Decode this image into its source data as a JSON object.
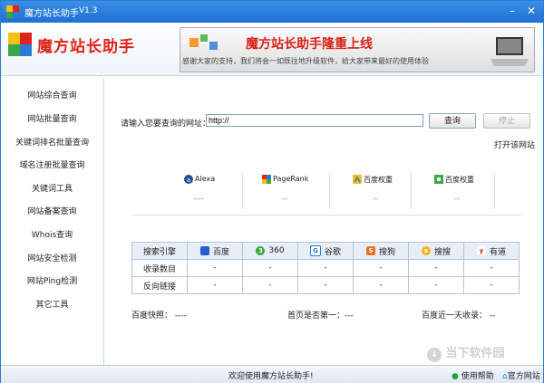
{
  "window": {
    "title": "魔方站长助手",
    "version": "V1.3"
  },
  "header": {
    "logo_text": "魔方站长助手",
    "banner_title": "魔方站长助手隆重上线",
    "banner_subtitle": "感谢大家的支持，我们将会一如既往地升级软件，给大家带来最好的使用体验"
  },
  "sidebar": {
    "items": [
      {
        "label": "网站综合查询"
      },
      {
        "label": "网站批量查询"
      },
      {
        "label": "关键词排名批量查询"
      },
      {
        "label": "域名注册批量查询"
      },
      {
        "label": "关键词工具"
      },
      {
        "label": "网站备案查询"
      },
      {
        "label": "Whois查询"
      },
      {
        "label": "网站安全检测"
      },
      {
        "label": "网站Ping检测"
      },
      {
        "label": "其它工具"
      }
    ]
  },
  "query": {
    "label": "请输入您要查询的网址：",
    "url_value": "http://",
    "search_button": "查询",
    "stop_button": "停止",
    "open_site": "打开该网站"
  },
  "ranks": [
    {
      "name": "Alexa",
      "value": "----"
    },
    {
      "name": "PageRank",
      "value": "--"
    },
    {
      "name": "百度权重",
      "value": "--"
    },
    {
      "name": "百度权重",
      "value": "--"
    }
  ],
  "table": {
    "header": "搜索引擎",
    "engines": [
      "百度",
      "360",
      "谷歌",
      "搜狗",
      "搜搜",
      "有道"
    ],
    "rows": [
      {
        "label": "收录数目",
        "values": [
          "-",
          "-",
          "-",
          "-",
          "-",
          "-"
        ]
      },
      {
        "label": "反向链接",
        "values": [
          "-",
          "-",
          "-",
          "-",
          "-",
          "-"
        ]
      }
    ]
  },
  "stats": {
    "snapshot_label": "百度快照：",
    "snapshot_value": "----",
    "homepage_label": "首页是否第一：",
    "homepage_value": "---",
    "recent_label": "百度近一天收录：",
    "recent_value": "--"
  },
  "status": {
    "welcome": "欢迎使用魔方站长助手!",
    "help": "使用帮助",
    "site": "官方网站"
  },
  "watermark": "当下软件园"
}
